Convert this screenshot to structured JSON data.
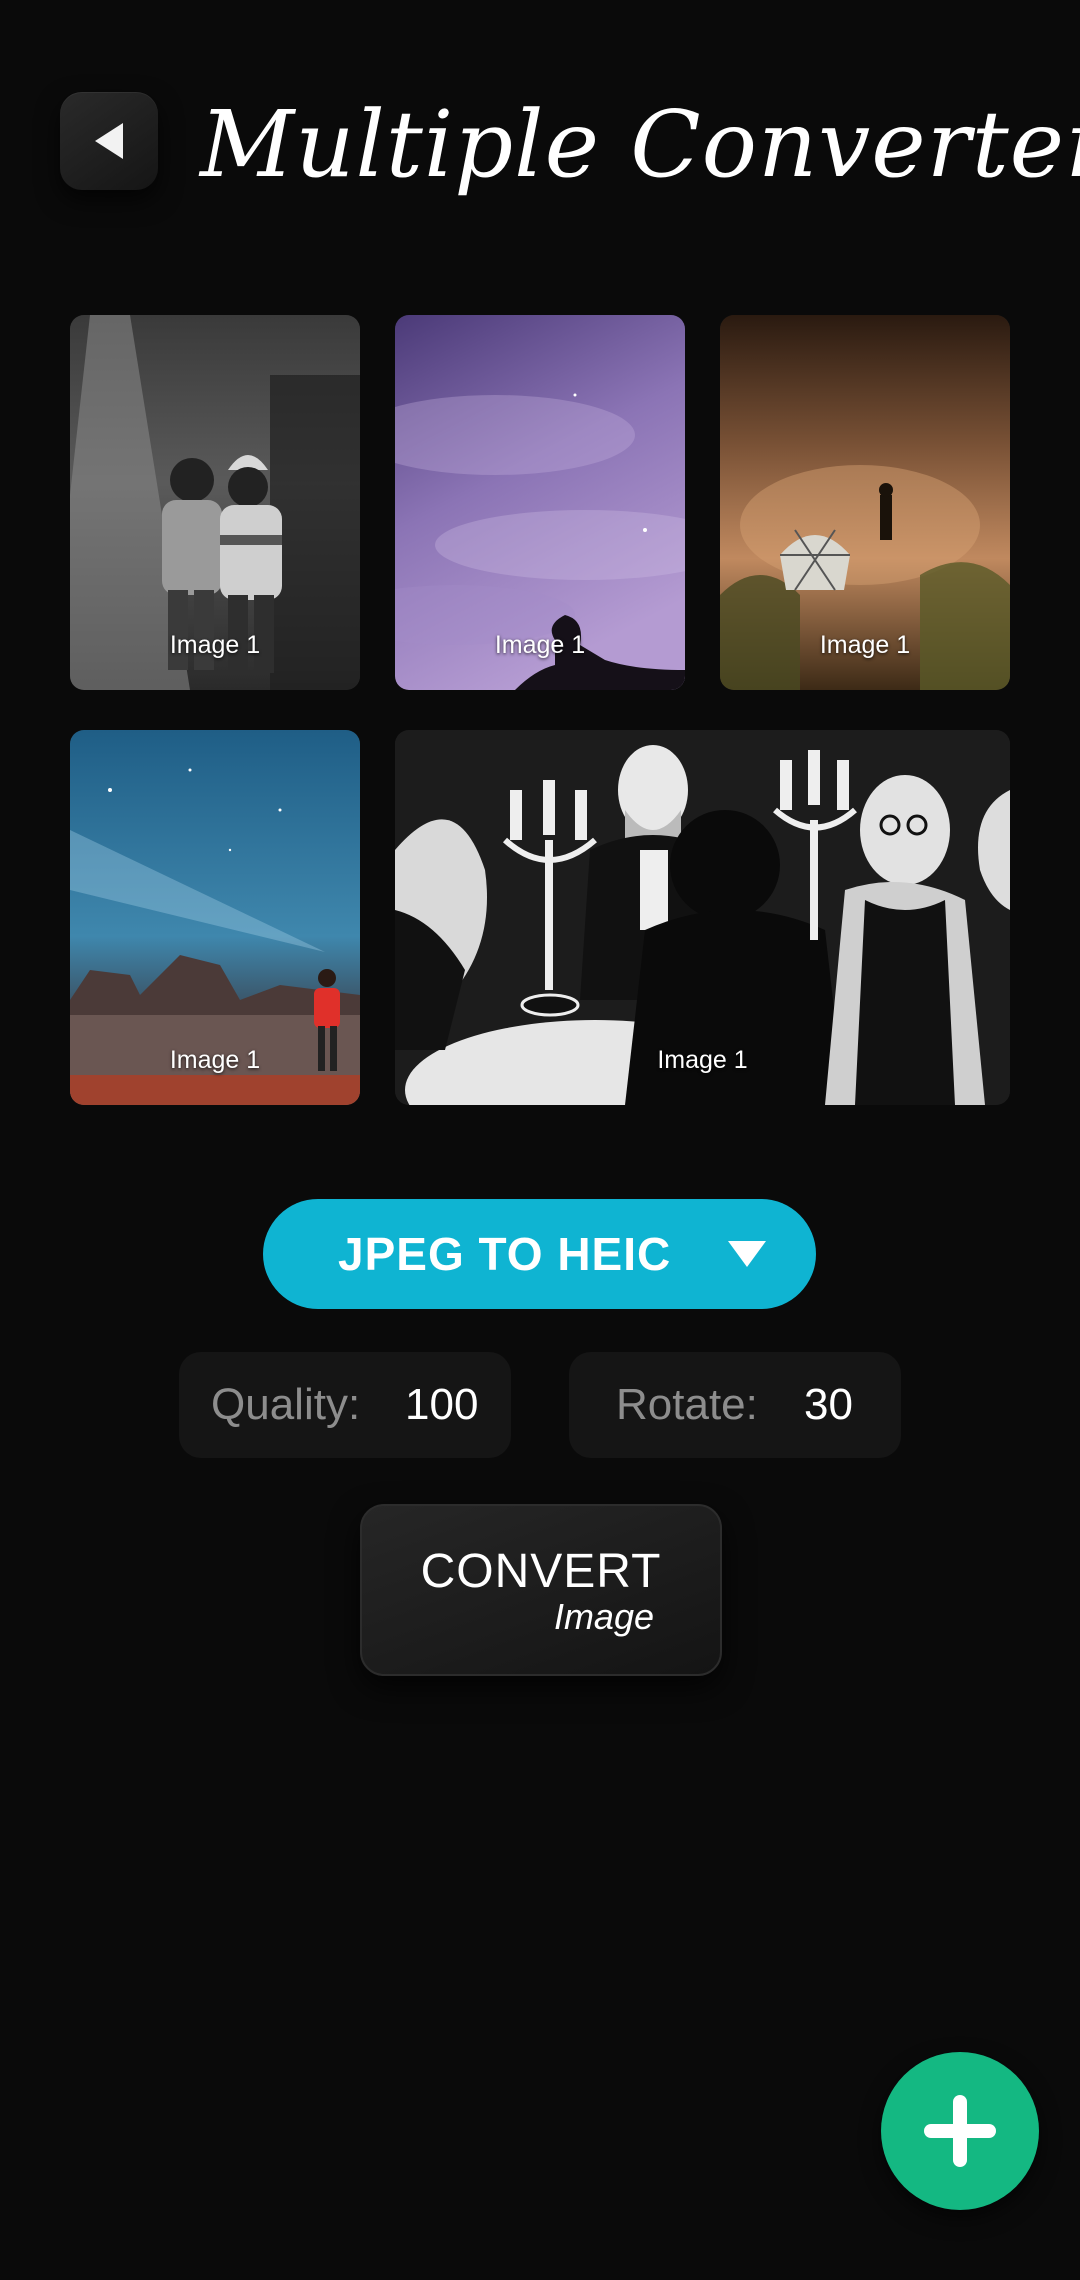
{
  "header": {
    "title": "Multiple Converter",
    "back_icon": "back-arrow-icon"
  },
  "images": [
    {
      "label": "Image 1",
      "scene": "black-and-white photo of two children walking on a road"
    },
    {
      "label": "Image 1",
      "scene": "purple night sky with a sitting silhouette"
    },
    {
      "label": "Image 1",
      "scene": "desert with a dome tent and a standing person"
    },
    {
      "label": "Image 1",
      "scene": "starry blue night with a person holding a headlamp beam"
    },
    {
      "label": "Image 1",
      "scene": "black-and-white illustration of people around a table with candelabras"
    }
  ],
  "format": {
    "label": "JPEG TO HEIC",
    "icon": "caret-down-icon",
    "color": "#0fb4d2"
  },
  "options": {
    "quality_label": "Quality:",
    "quality_value": "100",
    "rotate_label": "Rotate:",
    "rotate_value": "30"
  },
  "convert": {
    "main_label": "CONVERT",
    "sub_label": "Image"
  },
  "fab": {
    "icon": "plus-icon",
    "color": "#14b882"
  }
}
